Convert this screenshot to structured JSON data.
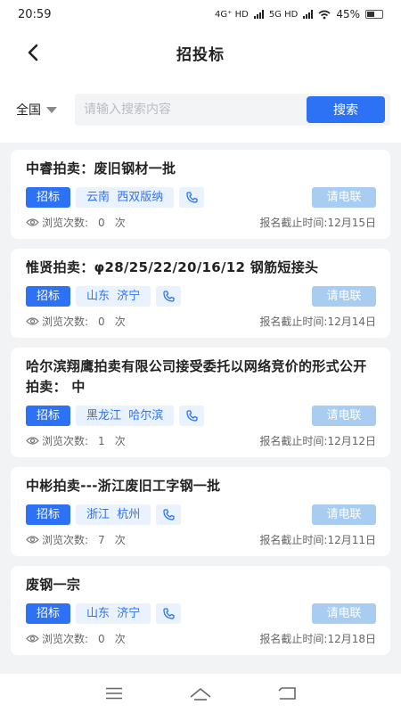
{
  "status_bar": {
    "time": "20:59",
    "net1": "4G⁺ HD",
    "net2": "5G HD",
    "battery": "45%"
  },
  "header": {
    "title": "招投标"
  },
  "search": {
    "region": "全国",
    "placeholder": "请输入搜索内容",
    "button": "搜索"
  },
  "labels": {
    "views_prefix": "浏览次数:",
    "views_unit": "次"
  },
  "colors": {
    "accent": "#2d72f5",
    "tag_bg": "#eaf2fe",
    "call_btn": "#a9cdf1"
  },
  "items": [
    {
      "title": "中睿拍卖：废旧钢材一批",
      "type": "招标",
      "region": "云南  西双版纳",
      "call": "请电联",
      "views": "0",
      "deadline": "报名截止时间:12月15日"
    },
    {
      "title": "惟贤拍卖：φ28/25/22/20/16/12 钢筋短接头",
      "type": "招标",
      "region": "山东  济宁",
      "call": "请电联",
      "views": "0",
      "deadline": "报名截止时间:12月14日"
    },
    {
      "title": "哈尔滨翔鹰拍卖有限公司接受委托以网络竞价的形式公开拍卖：  中",
      "type": "招标",
      "region": "黑龙江  哈尔滨",
      "call": "请电联",
      "views": "1",
      "deadline": "报名截止时间:12月12日"
    },
    {
      "title": "中彬拍卖---浙江废旧工字钢一批",
      "type": "招标",
      "region": "浙江  杭州",
      "call": "请电联",
      "views": "7",
      "deadline": "报名截止时间:12月11日"
    },
    {
      "title": "废钢一宗",
      "type": "招标",
      "region": "山东  济宁",
      "call": "请电联",
      "views": "0",
      "deadline": "报名截止时间:12月18日"
    }
  ]
}
